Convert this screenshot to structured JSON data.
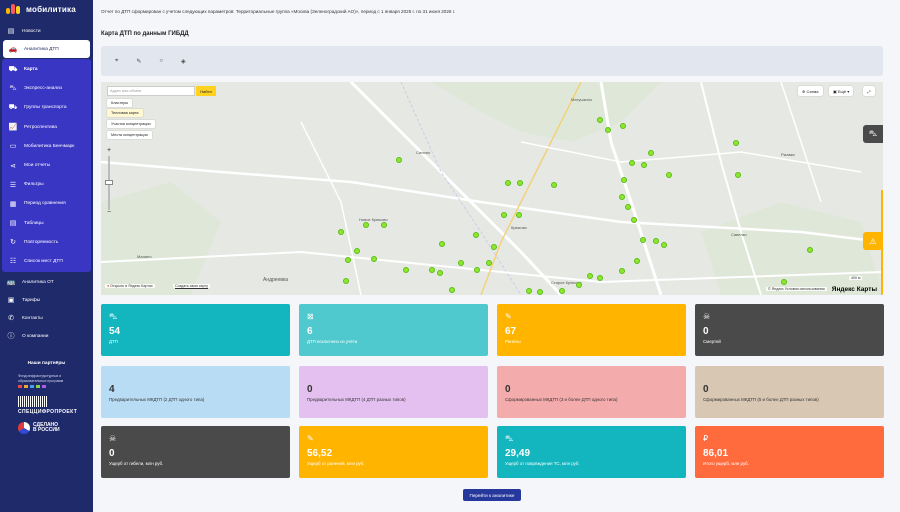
{
  "app": {
    "name": "мобилитика"
  },
  "sidebar": {
    "top_items": [
      {
        "label": "Новости",
        "icon": "news-icon"
      },
      {
        "label": "Аналитика ДТП",
        "icon": "car-crash-icon"
      }
    ],
    "sub_items": [
      {
        "label": "Карта",
        "icon": "map-icon"
      },
      {
        "label": "Экспресс-анализ",
        "icon": "car-icon"
      },
      {
        "label": "Группы транспорта",
        "icon": "truck-icon"
      },
      {
        "label": "Ретроспектива",
        "icon": "chart-icon"
      },
      {
        "label": "Мобилитика Бенчмарк",
        "icon": "benchmark-icon"
      },
      {
        "label": "Мои отчеты",
        "icon": "share-icon"
      },
      {
        "label": "Фильтры",
        "icon": "filter-icon"
      },
      {
        "label": "Период сравнения",
        "icon": "calendar-icon"
      },
      {
        "label": "Таблицы",
        "icon": "table-icon"
      },
      {
        "label": "Повторяемость",
        "icon": "repeat-icon"
      },
      {
        "label": "Список мест ДТП",
        "icon": "list-icon"
      }
    ],
    "bottom_items": [
      {
        "label": "Аналитика ОТ",
        "icon": "bus-icon"
      },
      {
        "label": "Тарифы",
        "icon": "wallet-icon"
      },
      {
        "label": "Контакты",
        "icon": "phone-icon"
      },
      {
        "label": "О компании",
        "icon": "info-icon"
      }
    ],
    "partners_title": "Наши партнёры",
    "partner1": "Фонд инфраструктурных и образовательных программ",
    "partner2": "СПЕЦЦИФРОПРОЕКТ",
    "partner3_line1": "СДЕЛАНО",
    "partner3_line2": "В РОССИИ"
  },
  "main": {
    "report_text": "Отчет по ДТП сформирован с учетом следующих параметров: Территориальные группа «Москва (Зеленоградский АО)», период с 1 января 2025 г. по 31 июня 2026 г.",
    "map_title": "Карта ДТП по данным ГИБДД",
    "tools": [
      "⌖",
      "✎",
      "○",
      "◈"
    ],
    "map": {
      "search_placeholder": "Адрес или объект",
      "find_label": "Найти",
      "layers": [
        "Кластеры",
        "Тепловая карта",
        "Участки концентрации",
        "Места концентрации"
      ],
      "schema_label": "Схема",
      "more_label": "Ещё",
      "places": [
        "Матушкино",
        "Силино",
        "Крюково",
        "Старое Крюково",
        "Андреевка",
        "Савелки",
        "Малино",
        "Новое Крюково",
        "Ржавки"
      ],
      "footer_open": "Открыть в Яндекс Картах",
      "footer_create": "Создать свою карту",
      "footer_terms": "© Яндекс Условия использования",
      "scale": "400 м",
      "brand": "Яндекс Карты"
    },
    "cards": [
      {
        "value": "54",
        "label": "ДТП",
        "icon": "car-icon"
      },
      {
        "value": "6",
        "label": "ДТП исключено из учёта",
        "icon": "excluded-icon"
      },
      {
        "value": "67",
        "label": "Ранены",
        "icon": "injury-icon"
      },
      {
        "value": "0",
        "label": "Смертей",
        "icon": "skull-icon"
      },
      {
        "value": "4",
        "label": "Предварительных МКДТП (2 ДТП одного типа)",
        "icon": ""
      },
      {
        "value": "0",
        "label": "Предварительных МКДТП (4 ДТП разных типов)",
        "icon": ""
      },
      {
        "value": "0",
        "label": "Сформированных МКДТП (3 и более ДТП одного типа)",
        "icon": ""
      },
      {
        "value": "0",
        "label": "Сформированных МКДТП (5 и более ДТП разных типов)",
        "icon": ""
      },
      {
        "value": "0",
        "label": "Ущерб от гибели, млн руб.",
        "icon": "skull-icon"
      },
      {
        "value": "56,52",
        "label": "Ущерб от ранений, млн руб.",
        "icon": "injury-icon"
      },
      {
        "value": "29,49",
        "label": "Ущерб от повреждения ТС, млн руб.",
        "icon": "car-icon"
      },
      {
        "value": "86,01",
        "label": "Итого ущерб, млн руб.",
        "icon": "ruble-icon"
      }
    ],
    "go_button": "Перейти к аналитике"
  }
}
